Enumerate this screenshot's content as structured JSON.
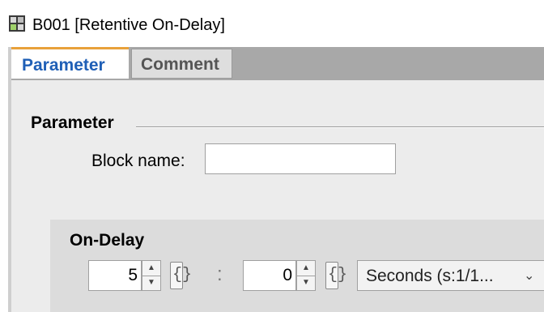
{
  "window": {
    "title": "B001 [Retentive On-Delay]",
    "icon": "logo-block-icon"
  },
  "tabs": [
    {
      "label": "Parameter",
      "active": true
    },
    {
      "label": "Comment",
      "active": false
    }
  ],
  "parameter_group": {
    "label": "Parameter",
    "block_name_label": "Block name:",
    "block_name_value": ""
  },
  "on_delay": {
    "label": "On-Delay",
    "first_value": "5",
    "separator": ":",
    "second_value": "0",
    "unit_selected": "Seconds (s:1/1..."
  },
  "colors": {
    "active_tab_text": "#1f5fb6",
    "active_tab_accent": "#e8a13a",
    "panel_bg": "#ececec"
  }
}
